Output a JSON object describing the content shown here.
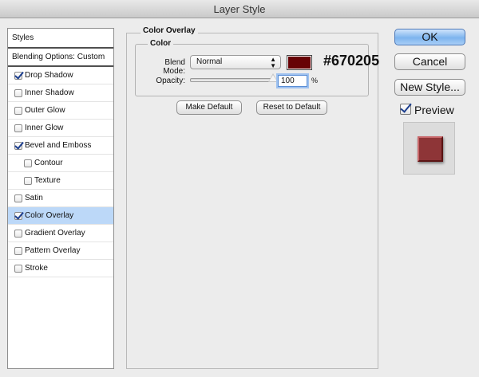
{
  "window": {
    "title": "Layer Style"
  },
  "styles_panel": {
    "header": "Styles",
    "blending_options": "Blending Options: Custom",
    "items": [
      {
        "label": "Drop Shadow",
        "checked": true,
        "selected": false,
        "sub": false
      },
      {
        "label": "Inner Shadow",
        "checked": false,
        "selected": false,
        "sub": false
      },
      {
        "label": "Outer Glow",
        "checked": false,
        "selected": false,
        "sub": false
      },
      {
        "label": "Inner Glow",
        "checked": false,
        "selected": false,
        "sub": false
      },
      {
        "label": "Bevel and Emboss",
        "checked": true,
        "selected": false,
        "sub": false
      },
      {
        "label": "Contour",
        "checked": false,
        "selected": false,
        "sub": true
      },
      {
        "label": "Texture",
        "checked": false,
        "selected": false,
        "sub": true
      },
      {
        "label": "Satin",
        "checked": false,
        "selected": false,
        "sub": false
      },
      {
        "label": "Color Overlay",
        "checked": true,
        "selected": true,
        "sub": false
      },
      {
        "label": "Gradient Overlay",
        "checked": false,
        "selected": false,
        "sub": false
      },
      {
        "label": "Pattern Overlay",
        "checked": false,
        "selected": false,
        "sub": false
      },
      {
        "label": "Stroke",
        "checked": false,
        "selected": false,
        "sub": false
      }
    ]
  },
  "color_overlay": {
    "section_title": "Color Overlay",
    "group_title": "Color",
    "blend_mode_label": "Blend Mode:",
    "blend_mode_value": "Normal",
    "overlay_color": "#670205",
    "hex_text": "#670205",
    "opacity_label": "Opacity:",
    "opacity_value": "100",
    "opacity_unit": "%",
    "opacity_level": 1.0,
    "make_default_label": "Make Default",
    "reset_default_label": "Reset to Default"
  },
  "actions": {
    "ok_label": "OK",
    "cancel_label": "Cancel",
    "new_style_label": "New Style...",
    "preview_label": "Preview",
    "preview_checked": true
  },
  "colors": {
    "preview_fill": "#8e3537",
    "selection": "#bcd8f8"
  }
}
